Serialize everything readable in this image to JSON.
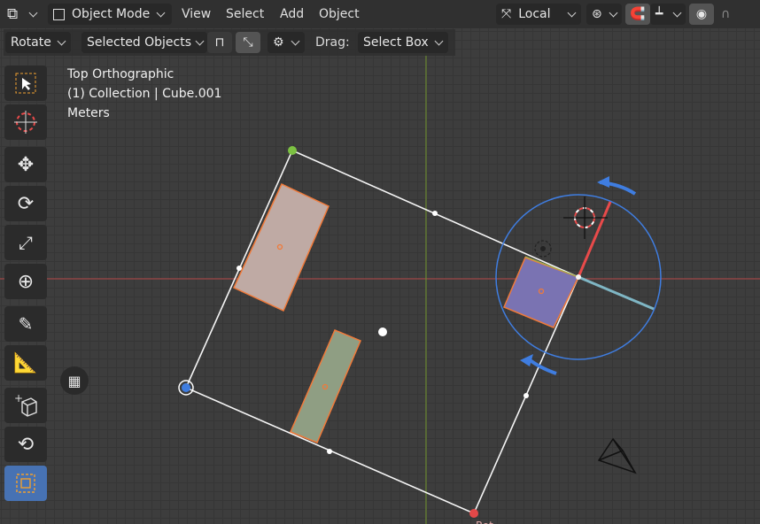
{
  "header": {
    "mode_label": "Object Mode",
    "menus": [
      "View",
      "Select",
      "Add",
      "Object"
    ],
    "transform_orientation": "Local"
  },
  "tool_settings": {
    "transform_tool": "Rotate",
    "affect": "Selected Objects",
    "drag_label": "Drag:",
    "drag_value": "Select Box"
  },
  "viewport_info": {
    "view_name": "Top Orthographic",
    "collection_line": "(1) Collection | Cube.001",
    "units": "Meters"
  },
  "toolbar": {
    "tools": [
      "cursor-select-icon",
      "3d-cursor-icon",
      "move-icon",
      "rotate-icon",
      "scale-icon",
      "transform-icon",
      "annotate-icon",
      "measure-icon",
      "add-cube-icon",
      "spin-icon",
      "select-box-icon"
    ],
    "active_tool": "select-box-icon"
  },
  "colors": {
    "header_bg": "#303030",
    "viewport_bg": "#3d3d3d",
    "active_blue": "#4772b3",
    "x_axis_red": "#c24a4a",
    "y_axis_green": "#6c8a32",
    "gizmo_blue": "#3f7de0",
    "cube_pink": "#bfaaa4",
    "cube_green": "#8f9e83",
    "cube_purple": "#7a73b2",
    "selection_orange": "#f07a3a"
  }
}
